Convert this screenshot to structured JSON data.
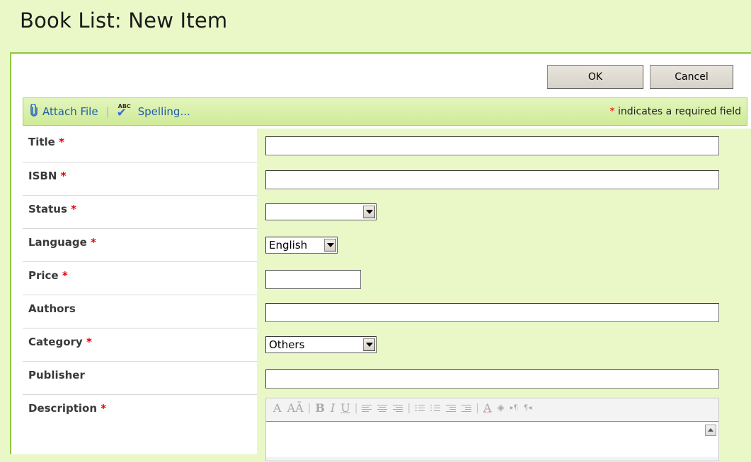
{
  "page": {
    "title": "Book List: New Item"
  },
  "buttons": {
    "ok": "OK",
    "cancel": "Cancel"
  },
  "toolbar": {
    "attach_file": "Attach File",
    "separator": "|",
    "spelling": "Spelling...",
    "spelling_icon_text": "ABC",
    "required_star": "*",
    "required_note": " indicates a required field"
  },
  "fields": [
    {
      "label": "Title",
      "required": "*",
      "type": "text",
      "value": ""
    },
    {
      "label": "ISBN",
      "required": "*",
      "type": "text",
      "value": ""
    },
    {
      "label": "Status",
      "required": "*",
      "type": "select",
      "value": ""
    },
    {
      "label": "Language",
      "required": "*",
      "type": "select",
      "value": "English"
    },
    {
      "label": "Price",
      "required": "*",
      "type": "text-short",
      "value": ""
    },
    {
      "label": "Authors",
      "required": "",
      "type": "text",
      "value": ""
    },
    {
      "label": "Category",
      "required": "*",
      "type": "select",
      "value": "Others"
    },
    {
      "label": "Publisher",
      "required": "",
      "type": "text",
      "value": ""
    },
    {
      "label": "Description",
      "required": "*",
      "type": "richtext",
      "value": ""
    }
  ],
  "rte_toolbar": {
    "font": "A",
    "font_size": "AĀ",
    "bold": "B",
    "italic": "I",
    "underline": "U",
    "font_color": "A",
    "ltr": "▸¶",
    "rtl": "¶◂"
  },
  "colors": {
    "accent_green": "#8cc63f",
    "field_bg": "#eaf8c8",
    "link_blue": "#1f5ba8",
    "required_red": "#e60000"
  }
}
